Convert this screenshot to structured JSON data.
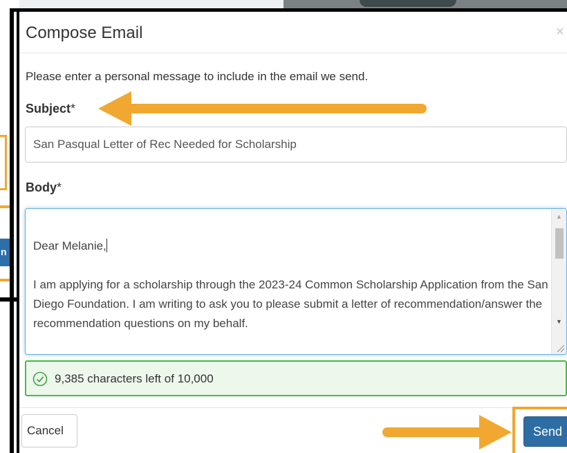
{
  "modal": {
    "title": "Compose Email",
    "close_glyph": "×",
    "intro": "Please enter a personal message to include in the email we send.",
    "subject_label": "Subject",
    "subject_required": "*",
    "subject_value": "San Pasqual Letter of Rec Needed for Scholarship",
    "body_label": "Body",
    "body_required": "*",
    "body_greeting": "Dear Melanie,",
    "body_paragraph": "I am applying for a scholarship through the 2023-24 Common Scholarship Application from the San Diego Foundation. I am writing to ask you to please submit a letter of recommendation/answer the recommendation questions on my behalf.",
    "char_count": "9,385 characters left of 10,000",
    "cancel_label": "Cancel",
    "send_label": "Send"
  },
  "background": {
    "left_button_fragment": "n"
  },
  "colors": {
    "annotation_orange": "#f0a830",
    "primary_blue": "#2e6da4",
    "success_green": "#3fbf3f",
    "success_bg": "#eef7ec"
  },
  "icons": {
    "check": "check-circle-icon",
    "close": "close-icon",
    "arrow": "arrow-left-annotation"
  }
}
